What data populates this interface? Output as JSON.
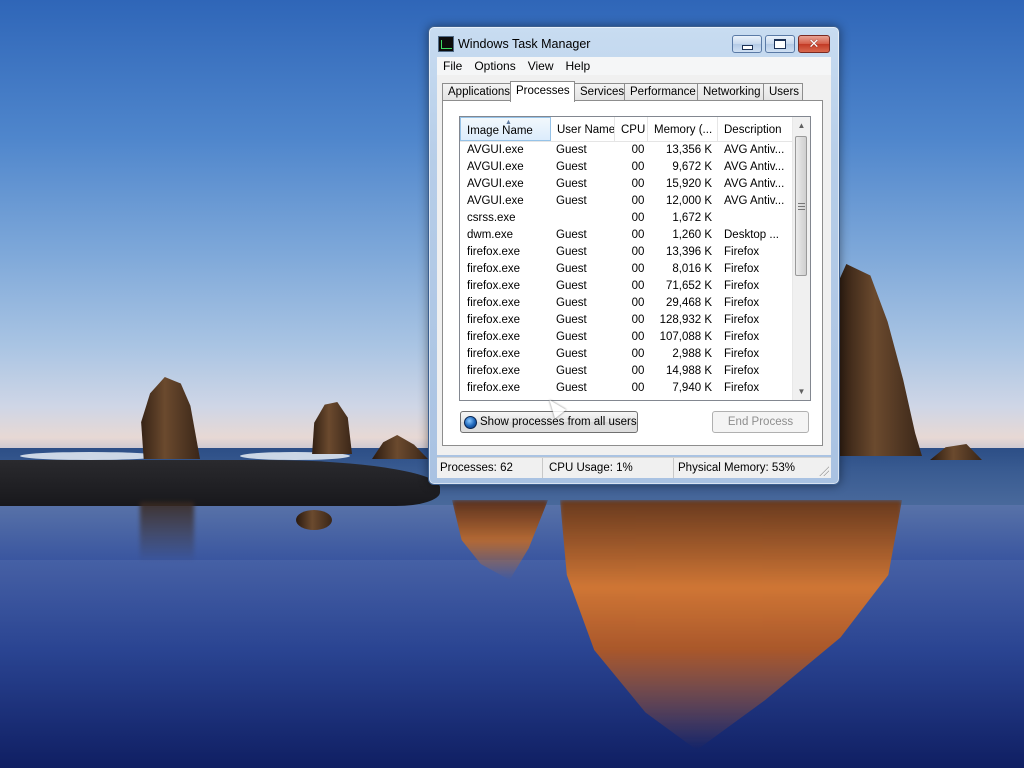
{
  "window": {
    "title": "Windows Task Manager",
    "icon": "task-manager-icon"
  },
  "menu": [
    "File",
    "Options",
    "View",
    "Help"
  ],
  "tabs": [
    {
      "label": "Applications",
      "active": false
    },
    {
      "label": "Processes",
      "active": true
    },
    {
      "label": "Services",
      "active": false
    },
    {
      "label": "Performance",
      "active": false
    },
    {
      "label": "Networking",
      "active": false
    },
    {
      "label": "Users",
      "active": false
    }
  ],
  "processes": {
    "columns": [
      "Image Name",
      "User Name",
      "CPU",
      "Memory (...",
      "Description"
    ],
    "sorted_column": "Image Name",
    "rows": [
      {
        "name": "AVGUI.exe",
        "user": "Guest",
        "cpu": "00",
        "memory": "13,356 K",
        "description": "AVG Antiv..."
      },
      {
        "name": "AVGUI.exe",
        "user": "Guest",
        "cpu": "00",
        "memory": "9,672 K",
        "description": "AVG Antiv..."
      },
      {
        "name": "AVGUI.exe",
        "user": "Guest",
        "cpu": "00",
        "memory": "15,920 K",
        "description": "AVG Antiv..."
      },
      {
        "name": "AVGUI.exe",
        "user": "Guest",
        "cpu": "00",
        "memory": "12,000 K",
        "description": "AVG Antiv..."
      },
      {
        "name": "csrss.exe",
        "user": "",
        "cpu": "00",
        "memory": "1,672 K",
        "description": ""
      },
      {
        "name": "dwm.exe",
        "user": "Guest",
        "cpu": "00",
        "memory": "1,260 K",
        "description": "Desktop ..."
      },
      {
        "name": "firefox.exe",
        "user": "Guest",
        "cpu": "00",
        "memory": "13,396 K",
        "description": "Firefox"
      },
      {
        "name": "firefox.exe",
        "user": "Guest",
        "cpu": "00",
        "memory": "8,016 K",
        "description": "Firefox"
      },
      {
        "name": "firefox.exe",
        "user": "Guest",
        "cpu": "00",
        "memory": "71,652 K",
        "description": "Firefox"
      },
      {
        "name": "firefox.exe",
        "user": "Guest",
        "cpu": "00",
        "memory": "29,468 K",
        "description": "Firefox"
      },
      {
        "name": "firefox.exe",
        "user": "Guest",
        "cpu": "00",
        "memory": "128,932 K",
        "description": "Firefox"
      },
      {
        "name": "firefox.exe",
        "user": "Guest",
        "cpu": "00",
        "memory": "107,088 K",
        "description": "Firefox"
      },
      {
        "name": "firefox.exe",
        "user": "Guest",
        "cpu": "00",
        "memory": "2,988 K",
        "description": "Firefox"
      },
      {
        "name": "firefox.exe",
        "user": "Guest",
        "cpu": "00",
        "memory": "14,988 K",
        "description": "Firefox"
      },
      {
        "name": "firefox.exe",
        "user": "Guest",
        "cpu": "00",
        "memory": "7,940 K",
        "description": "Firefox"
      }
    ]
  },
  "buttons": {
    "show_all": "Show processes from all users",
    "end_process": "End Process"
  },
  "status": {
    "processes": "Processes: 62",
    "cpu": "CPU Usage: 1%",
    "memory": "Physical Memory: 53%"
  }
}
